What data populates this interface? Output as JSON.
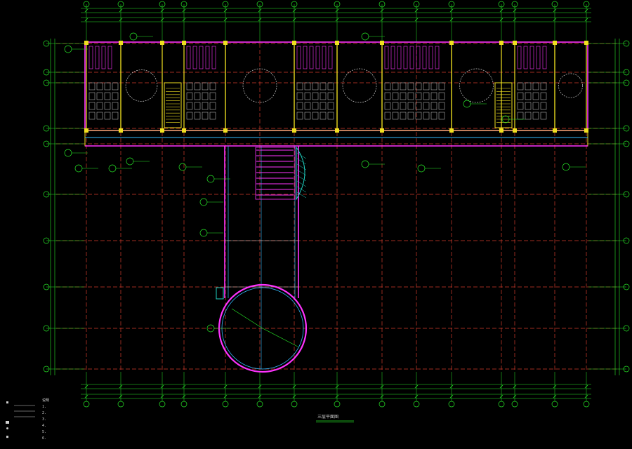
{
  "drawing": {
    "colors": {
      "background": "#000000",
      "grid": "#d23c2c",
      "axis": "#27e627",
      "wall": "#ff33ff",
      "structure": "#f0e020",
      "furniture": "#d0d0d0",
      "annotation": "#27e627",
      "detail": "#33bbff",
      "hatch": "#20d0c0"
    },
    "icons": [
      "stair-symbol",
      "column-symbol",
      "circle-hall-symbol",
      "hatch-pattern",
      "section-marker"
    ],
    "notes": [
      "说明",
      "1.",
      "2.",
      "3.",
      "4.",
      "5.",
      "6."
    ],
    "legend": [
      "■",
      "●",
      "■"
    ],
    "plan_title": "三层平面图"
  }
}
